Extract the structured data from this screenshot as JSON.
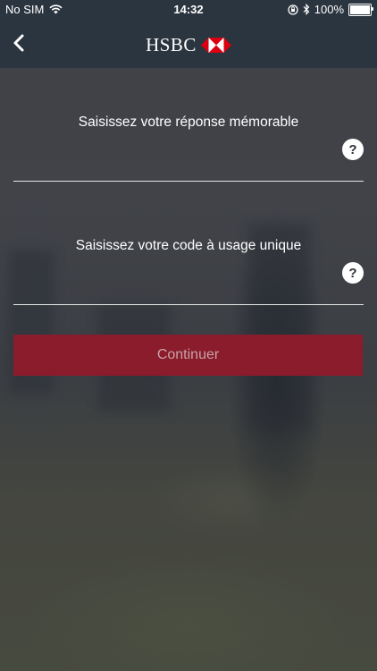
{
  "status_bar": {
    "carrier": "No SIM",
    "time": "14:32",
    "battery_text": "100%",
    "battery_level": 1.0,
    "icons": [
      "wifi-icon",
      "orientation-lock-icon",
      "bluetooth-icon",
      "battery-icon"
    ]
  },
  "nav": {
    "back_icon": "chevron-left-icon",
    "logo_text": "HSBC",
    "logo_mark": "hsbc-hexagon-logo"
  },
  "form": {
    "memorable_answer": {
      "label": "Saisissez votre réponse mémorable",
      "value": "",
      "help_icon": "?"
    },
    "one_time_code": {
      "label": "Saisissez votre code à usage unique",
      "value": "",
      "help_icon": "?"
    },
    "continue_label": "Continuer"
  },
  "colors": {
    "nav_background": "#2b3540",
    "button_background": "#8b1c2b",
    "brand_red": "#db0011"
  }
}
